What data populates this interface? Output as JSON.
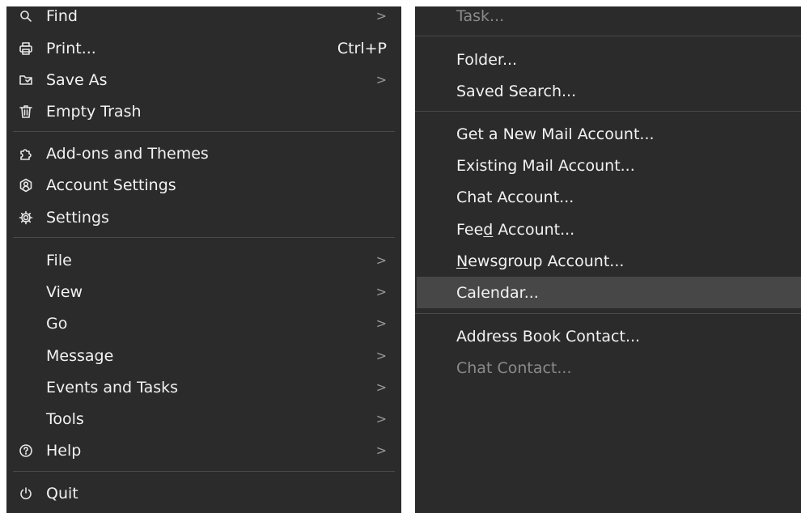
{
  "left_menu": {
    "find": {
      "label": "Find",
      "icon": "search-icon"
    },
    "print": {
      "label": "Print...",
      "shortcut": "Ctrl+P",
      "icon": "printer-icon"
    },
    "save_as": {
      "label": "Save As",
      "icon": "save-as-icon"
    },
    "empty_trash": {
      "label": "Empty Trash",
      "icon": "trash-icon"
    },
    "addons": {
      "label": "Add-ons and Themes",
      "icon": "puzzle-icon"
    },
    "account_settings": {
      "label": "Account Settings",
      "icon": "account-icon"
    },
    "settings": {
      "label": "Settings",
      "icon": "gear-icon"
    },
    "file": {
      "label": "File"
    },
    "view": {
      "label": "View"
    },
    "go": {
      "label": "Go"
    },
    "message": {
      "label": "Message"
    },
    "events_tasks": {
      "label": "Events and Tasks"
    },
    "tools": {
      "label": "Tools"
    },
    "help": {
      "label": "Help",
      "icon": "help-icon"
    },
    "quit": {
      "label": "Quit",
      "icon": "power-icon"
    },
    "submenu_arrow": ">"
  },
  "right_menu": {
    "task": "Task...",
    "folder": "Folder...",
    "saved_search": "Saved Search...",
    "new_mail_account": "Get a New Mail Account...",
    "existing_mail_account": "Existing Mail Account...",
    "chat_account": "Chat Account...",
    "feed_account": {
      "pre": "Fee",
      "key": "d",
      "post": " Account..."
    },
    "newsgroup_account": {
      "key": "N",
      "post": "ewsgroup Account..."
    },
    "calendar": "Calendar...",
    "address_book_contact": "Address Book Contact...",
    "chat_contact": "Chat Contact..."
  }
}
